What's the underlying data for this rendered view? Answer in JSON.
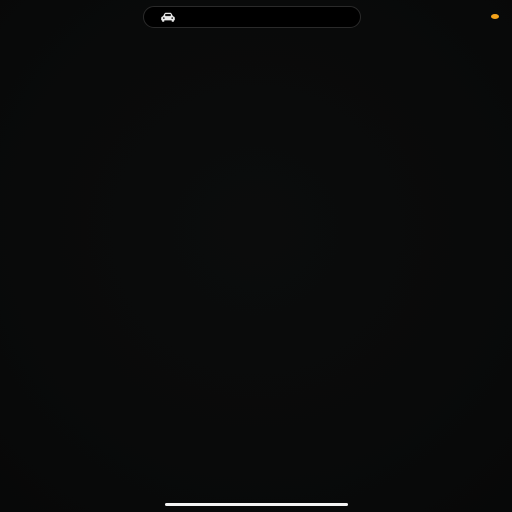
{
  "status_bar": {
    "activity_icon": "car-icon",
    "privacy_indicator_color": "#f5a31a"
  },
  "home_indicator": {
    "color": "#f4f4f4"
  },
  "background_color": "#090a0a"
}
